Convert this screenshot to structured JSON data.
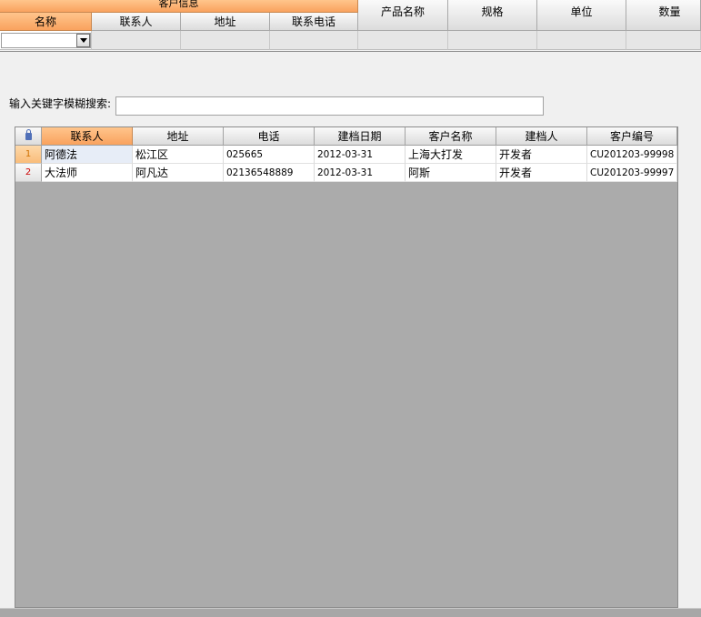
{
  "header": {
    "group_title": "客户信息",
    "sub_columns": [
      "名称",
      "联系人",
      "地址",
      "联系电话"
    ],
    "other_columns": [
      "产品名称",
      "规格",
      "单位",
      "数量"
    ]
  },
  "search": {
    "label": "输入关键字模糊搜索:",
    "value": ""
  },
  "grid": {
    "columns": [
      "联系人",
      "地址",
      "电话",
      "建档日期",
      "客户名称",
      "建档人",
      "客户编号"
    ],
    "rows": [
      {
        "num": "1",
        "cells": [
          "阿德法",
          "松江区",
          "025665",
          "2012-03-31",
          "上海大打发",
          "开发者",
          "CU201203-99998"
        ]
      },
      {
        "num": "2",
        "cells": [
          "大法师",
          "阿凡达",
          "02136548889",
          "2012-03-31",
          "阿斯",
          "开发者",
          "CU201203-99997"
        ]
      }
    ]
  },
  "colors": {
    "header_active": "#f9a25e",
    "grid_background": "#ababab",
    "row_number": "#cc0000"
  }
}
